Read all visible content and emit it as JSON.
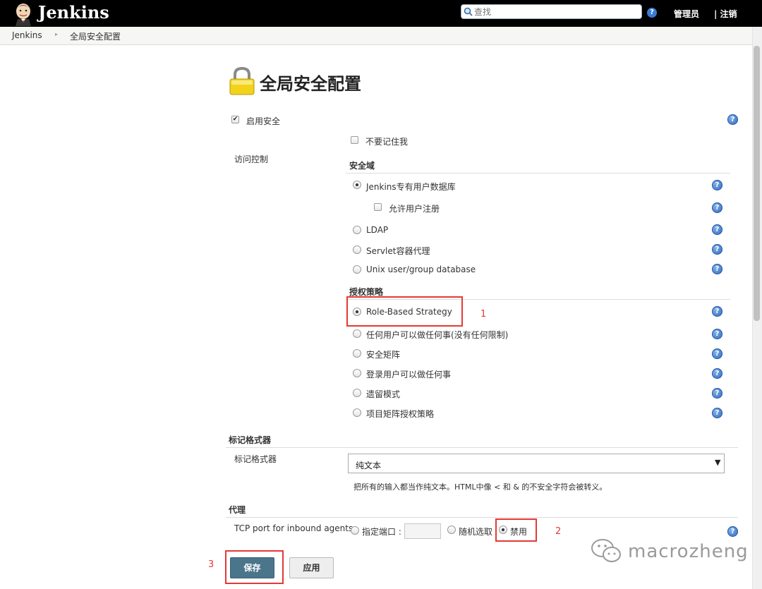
{
  "header": {
    "logo_text": "Jenkins",
    "search_placeholder": "查找",
    "help_glyph": "?",
    "admin_link": "管理员",
    "logout_link": "| 注销"
  },
  "breadcrumb": {
    "items": [
      "Jenkins",
      "全局安全配置"
    ],
    "separator": "▸"
  },
  "page": {
    "title": "全局安全配置"
  },
  "security": {
    "enable_security": {
      "label": "启用安全",
      "checked": true
    },
    "access_control_label": "访问控制",
    "remember_me": {
      "label": "不要记住我",
      "checked": false
    },
    "realm_section": "安全域",
    "realm_options": [
      {
        "label": "Jenkins专有用户数据库",
        "selected": true
      },
      {
        "label": "LDAP",
        "selected": false
      },
      {
        "label": "Servlet容器代理",
        "selected": false
      },
      {
        "label": "Unix user/group database",
        "selected": false
      }
    ],
    "allow_signup": {
      "label": "允许用户注册",
      "checked": false
    },
    "authz_section": "授权策略",
    "authz_options": [
      {
        "label": "Role-Based Strategy",
        "selected": true
      },
      {
        "label": "任何用户可以做任何事(没有任何限制)",
        "selected": false
      },
      {
        "label": "安全矩阵",
        "selected": false
      },
      {
        "label": "登录用户可以做任何事",
        "selected": false
      },
      {
        "label": "遗留模式",
        "selected": false
      },
      {
        "label": "项目矩阵授权策略",
        "selected": false
      }
    ]
  },
  "markup": {
    "section": "标记格式器",
    "field_label": "标记格式器",
    "selected": "纯文本",
    "description": "把所有的输入都当作纯文本。HTML中像 < 和 & 的不安全字符会被转义。"
  },
  "agents": {
    "section": "代理",
    "tcp_label": "TCP port for inbound agents",
    "option_fixed": "指定端口 :",
    "option_random": "随机选取",
    "option_disable": "禁用",
    "selected": "禁用"
  },
  "annotations": {
    "n1": "1",
    "n2": "2",
    "n3": "3"
  },
  "buttons": {
    "save": "保存",
    "apply": "应用"
  },
  "watermark": "macrozheng",
  "colors": {
    "header_bg": "#000000",
    "save_button": "#4b758b",
    "annotation_red": "#e53935",
    "help_blue": "#2f66b8"
  }
}
